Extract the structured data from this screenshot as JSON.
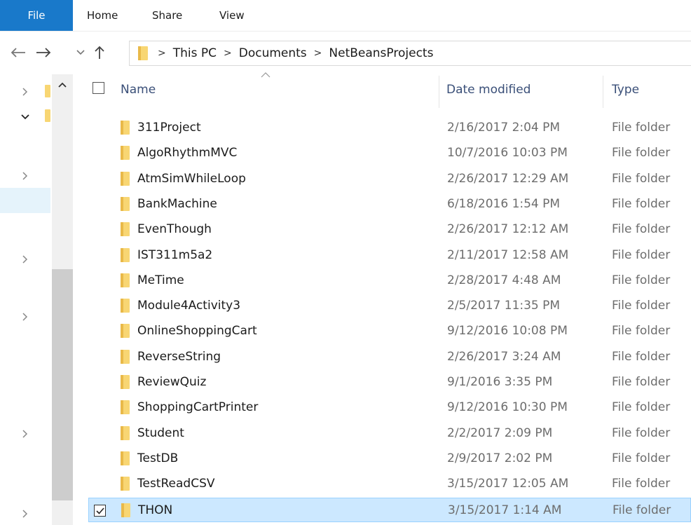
{
  "ribbon": {
    "file_label": "File",
    "tabs": [
      {
        "label": "Home"
      },
      {
        "label": "Share"
      },
      {
        "label": "View"
      }
    ]
  },
  "nav": {
    "back_icon": "arrow-left-icon",
    "forward_icon": "arrow-right-icon",
    "recent_icon": "chevron-down-icon",
    "up_icon": "arrow-up-icon"
  },
  "address": {
    "crumbs": [
      {
        "label": "This PC"
      },
      {
        "label": "Documents"
      },
      {
        "label": "NetBeansProjects"
      }
    ]
  },
  "columns": {
    "name": "Name",
    "date": "Date modified",
    "type": "Type"
  },
  "files": [
    {
      "name": "311Project",
      "date": "2/16/2017 2:04 PM",
      "type": "File folder"
    },
    {
      "name": "AlgoRhythmMVC",
      "date": "10/7/2016 10:03 PM",
      "type": "File folder"
    },
    {
      "name": "AtmSimWhileLoop",
      "date": "2/26/2017 12:29 AM",
      "type": "File folder"
    },
    {
      "name": "BankMachine",
      "date": "6/18/2016 1:54 PM",
      "type": "File folder"
    },
    {
      "name": "EvenThough",
      "date": "2/26/2017 12:12 AM",
      "type": "File folder"
    },
    {
      "name": "IST311m5a2",
      "date": "2/11/2017 12:58 AM",
      "type": "File folder"
    },
    {
      "name": "MeTime",
      "date": "2/28/2017 4:48 AM",
      "type": "File folder"
    },
    {
      "name": "Module4Activity3",
      "date": "2/5/2017 11:35 PM",
      "type": "File folder"
    },
    {
      "name": "OnlineShoppingCart",
      "date": "9/12/2016 10:08 PM",
      "type": "File folder"
    },
    {
      "name": "ReverseString",
      "date": "2/26/2017 3:24 AM",
      "type": "File folder"
    },
    {
      "name": "ReviewQuiz",
      "date": "9/1/2016 3:35 PM",
      "type": "File folder"
    },
    {
      "name": "ShoppingCartPrinter",
      "date": "9/12/2016 10:30 PM",
      "type": "File folder"
    },
    {
      "name": "Student",
      "date": "2/2/2017 2:09 PM",
      "type": "File folder"
    },
    {
      "name": "TestDB",
      "date": "2/9/2017 2:02 PM",
      "type": "File folder"
    },
    {
      "name": "TestReadCSV",
      "date": "3/15/2017 12:05 AM",
      "type": "File folder"
    },
    {
      "name": "THON",
      "date": "3/15/2017 1:14 AM",
      "type": "File folder",
      "selected": true
    }
  ],
  "colors": {
    "file_tab": "#1979ca",
    "selection": "#cce8ff",
    "folder": "#f8d673",
    "header_text": "#3a4f78"
  }
}
